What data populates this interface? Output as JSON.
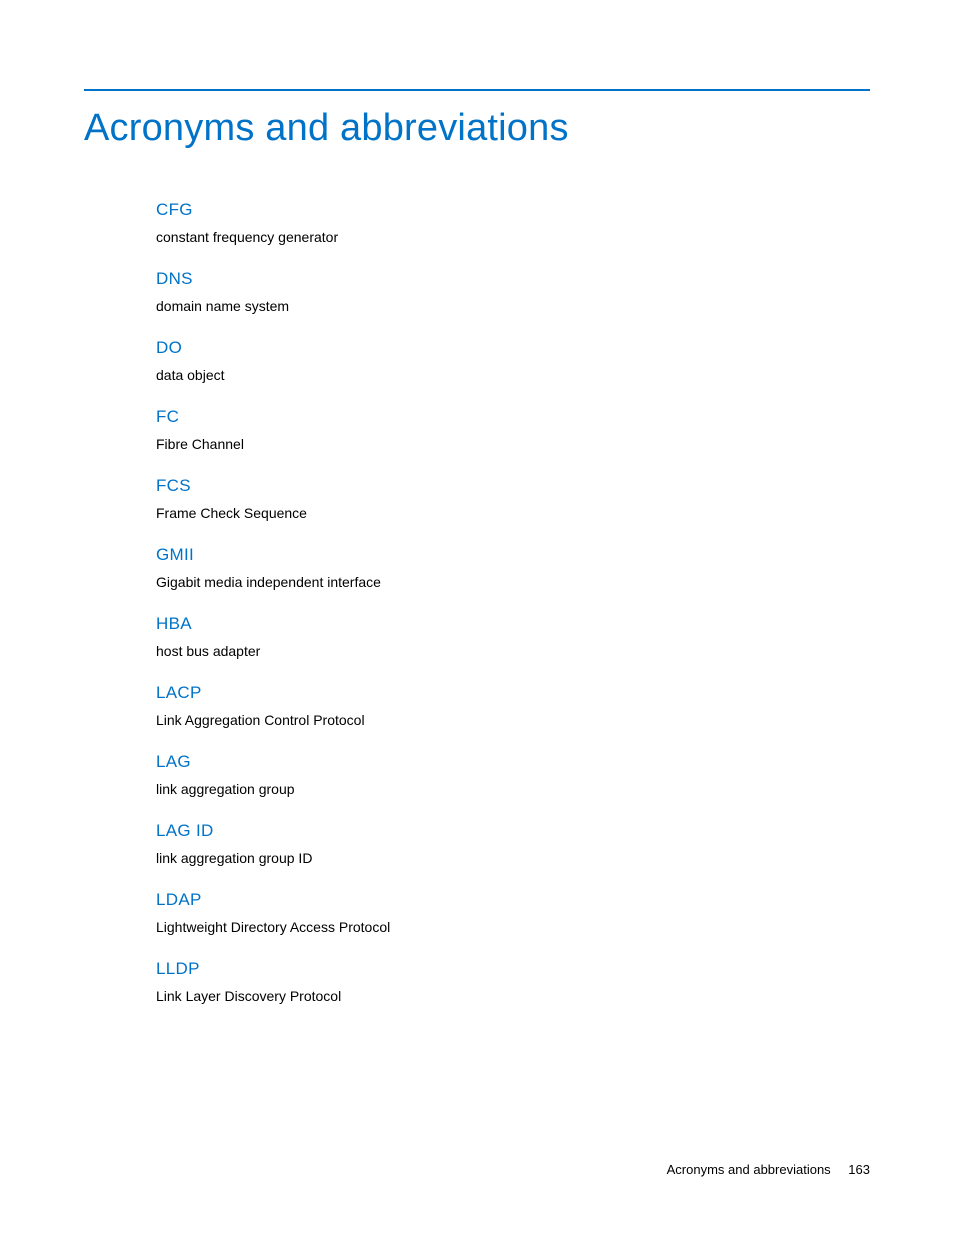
{
  "title": "Acronyms and abbreviations",
  "entries": [
    {
      "term": "CFG",
      "definition": "constant frequency generator"
    },
    {
      "term": "DNS",
      "definition": "domain name system"
    },
    {
      "term": "DO",
      "definition": "data object"
    },
    {
      "term": "FC",
      "definition": "Fibre Channel"
    },
    {
      "term": "FCS",
      "definition": "Frame Check Sequence"
    },
    {
      "term": "GMII",
      "definition": "Gigabit media independent interface"
    },
    {
      "term": "HBA",
      "definition": "host bus adapter"
    },
    {
      "term": "LACP",
      "definition": "Link Aggregation Control Protocol"
    },
    {
      "term": "LAG",
      "definition": "link aggregation group"
    },
    {
      "term": "LAG ID",
      "definition": "link aggregation group ID"
    },
    {
      "term": "LDAP",
      "definition": "Lightweight Directory Access Protocol"
    },
    {
      "term": "LLDP",
      "definition": "Link Layer Discovery Protocol"
    }
  ],
  "footer": {
    "section": "Acronyms and abbreviations",
    "page": "163"
  }
}
